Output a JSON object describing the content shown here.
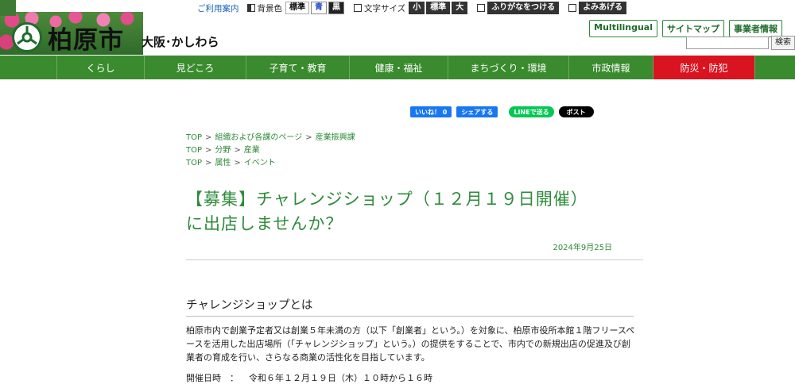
{
  "toolbar": {
    "guide": "ご利用案内",
    "bg_label": "背景色",
    "bg_options": [
      "標準",
      "青",
      "黒"
    ],
    "font_label": "文字サイズ",
    "font_options": [
      "小",
      "標準",
      "大"
    ],
    "furigana": "ふりがなをつける",
    "readaloud": "よみあげる"
  },
  "logo": {
    "name": "柏原市",
    "sub": "大阪･かしわら",
    "icon": "city-emblem-icon"
  },
  "header_links": [
    "Multilingual",
    "サイトマップ",
    "事業者情報"
  ],
  "search": {
    "button": "検索",
    "placeholder": ""
  },
  "nav": [
    {
      "label": "くらし"
    },
    {
      "label": "見どころ"
    },
    {
      "label": "子育て・教育"
    },
    {
      "label": "健康・福祉"
    },
    {
      "label": "まちづくり・環境"
    },
    {
      "label": "市政情報"
    },
    {
      "label": "防災・防犯"
    }
  ],
  "colors": {
    "nav_green": "#3a8a2e",
    "nav_red": "#d9131f",
    "accent_green": "#2e8b3a"
  },
  "social": {
    "fb_like": "いいね！ 0",
    "fb_share": "シェアする",
    "line": "LINEで送る",
    "x_post": "ポスト"
  },
  "breadcrumbs": [
    [
      "TOP",
      "組織および各課のページ",
      "産業振興課"
    ],
    [
      "TOP",
      "分野",
      "産業"
    ],
    [
      "TOP",
      "属性",
      "イベント"
    ]
  ],
  "article": {
    "title_line1": "【募集】チャレンジショップ（１２月１９日開催）",
    "title_line2": "に出店しませんか？",
    "date": "2024年9月25日",
    "section_heading": "チャレンジショップとは",
    "paragraph": "柏原市内で創業予定者又は創業５年未満の方（以下「創業者」という。）を対象に、柏原市役所本館１階フリースペースを活用した出店場所（「チャレンジショップ」という。）の提供をすることで、市内での新規出店の促進及び創業者の育成を行い、さらなる商業の活性化を目指しています。",
    "info_label": "開催日時",
    "info_colon": "：",
    "info_value": "令和６年１２月１９日（木）１０時から１６時"
  }
}
